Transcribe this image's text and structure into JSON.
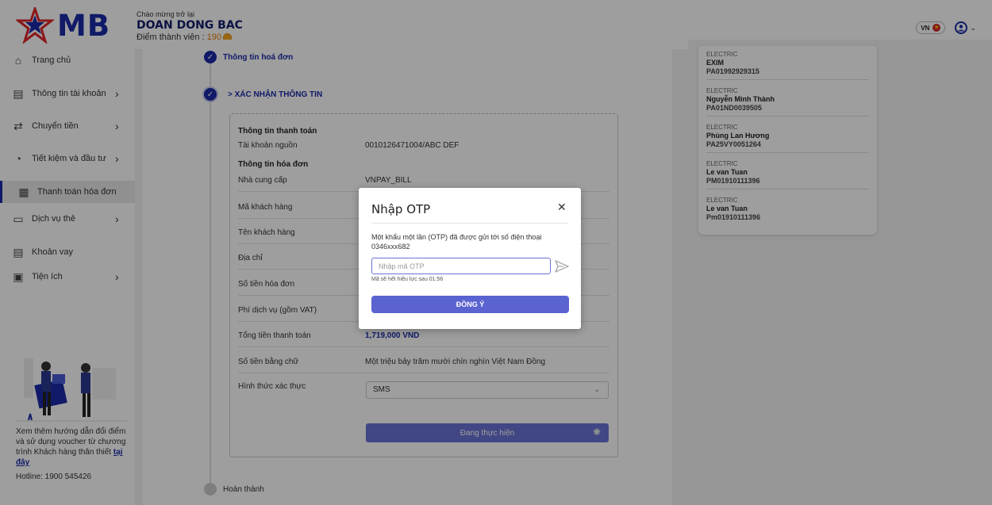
{
  "header": {
    "brand": "MB",
    "welcome": "Chào mừng trở lại",
    "username": "DOAN DONG BAC",
    "points_label": "Điểm thành viên :",
    "points_value": "190",
    "language": "VN"
  },
  "sidebar": {
    "items": [
      {
        "label": "Trang chủ"
      },
      {
        "label": "Thông tin tài khoản"
      },
      {
        "label": "Chuyển tiền"
      },
      {
        "label": "Tiết kiệm và đầu tư"
      },
      {
        "label": "Thanh toán hóa đơn"
      },
      {
        "label": "Dịch vụ thẻ"
      },
      {
        "label": "Khoản vay"
      },
      {
        "label": "Tiện ích"
      }
    ],
    "promo_text": "Xem thêm hướng dẫn đổi điểm và sử dụng voucher từ chương trình Khách hàng thân thiết",
    "promo_link": "tại đây",
    "hotline": "Hotline: 1900 545426"
  },
  "steps": {
    "step1": "Thông tin hoá đơn",
    "step2": "> XÁC NHẬN THÔNG TIN",
    "step3": "Hoàn thành"
  },
  "form": {
    "section_payment": "Thông tin thanh toán",
    "source_account_label": "Tài khoản nguồn",
    "source_account_value": "0010126471004/ABC DEF",
    "section_bill": "Thông tin hóa đơn",
    "provider_label": "Nhà cung cấp",
    "provider_value": "VNPAY_BILL",
    "customer_code_label": "Mã khách hàng",
    "customer_name_label": "Tên khách hàng",
    "address_label": "Địa chỉ",
    "bill_amount_label": "Số tiền hóa đơn",
    "service_fee_label": "Phí dịch vụ (gồm VAT)",
    "total_label": "Tổng tiền thanh toán",
    "total_value": "1,719,000 VND",
    "amount_words_label": "Số tiền bằng chữ",
    "amount_words_value": "Một triệu bảy trăm mười chín nghìn Việt Nam Đồng",
    "auth_label": "Hình thức xác thực",
    "auth_value": "SMS",
    "processing_label": "Đang thực hiện"
  },
  "recent": [
    {
      "type": "ELECTRIC",
      "name": "EXIM",
      "code": "PA01992929315"
    },
    {
      "type": "ELECTRIC",
      "name": "Nguyễn Minh Thành",
      "code": "PA01ND0039505"
    },
    {
      "type": "ELECTRIC",
      "name": "Phùng Lan Hương",
      "code": "PA25VY0051264"
    },
    {
      "type": "ELECTRIC",
      "name": "Le van Tuan",
      "code": "PM01910111396"
    },
    {
      "type": "ELECTRIC",
      "name": "Le van Tuan",
      "code": "Pm01910111396"
    }
  ],
  "modal": {
    "title": "Nhập OTP",
    "message": "Một khẩu một lần (OTP) đã được gửi tới số điện thoại 0346xxx682",
    "input_placeholder": "Nhập mã OTP",
    "input_value": "",
    "hint": "Mã sẽ hết hiệu lực sau 01:56",
    "confirm_label": "ĐỒNG Ý"
  },
  "colors": {
    "brand": "#1a2aa8",
    "button": "#5a63d0",
    "accent_orange": "#e57b00"
  },
  "icons": [
    "home-icon",
    "account-card-icon",
    "transfer-icon",
    "savings-icon",
    "bill-icon",
    "card-icon",
    "loan-icon",
    "utility-icon",
    "send-icon",
    "close-icon",
    "user-icon",
    "chevron-down-icon",
    "check-icon"
  ]
}
